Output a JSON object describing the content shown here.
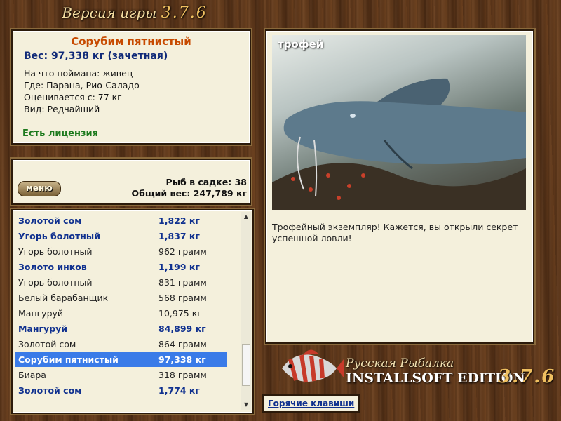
{
  "header": {
    "title_prefix": "Версия игры",
    "version": "3.7.6"
  },
  "fish_info": {
    "name": "Сорубим пятнистый",
    "weight": "Вес: 97,338 кг (зачетная)",
    "bait": "На что поймана: живец",
    "location": "Где: Парана, Рио-Саладо",
    "value": "Оценивается с: 77 кг",
    "rarity": "Вид: Редчайший",
    "license": "Есть лицензия"
  },
  "stats": {
    "menu_label": "меню",
    "fish_count": "Рыб в садке: 38",
    "total_weight": "Общий вес: 247,789 кг"
  },
  "catch_list": [
    {
      "name": "Золотой сом",
      "weight": "1,822 кг",
      "bold": true,
      "selected": false
    },
    {
      "name": "Угорь болотный",
      "weight": "1,837 кг",
      "bold": true,
      "selected": false
    },
    {
      "name": "Угорь болотный",
      "weight": "962 грамм",
      "bold": false,
      "selected": false
    },
    {
      "name": "Золото инков",
      "weight": "1,199 кг",
      "bold": true,
      "selected": false
    },
    {
      "name": "Угорь болотный",
      "weight": "831 грамм",
      "bold": false,
      "selected": false
    },
    {
      "name": "Белый барабанщик",
      "weight": "568 грамм",
      "bold": false,
      "selected": false
    },
    {
      "name": "Мангуруй",
      "weight": "10,975 кг",
      "bold": false,
      "selected": false
    },
    {
      "name": "Мангуруй",
      "weight": "84,899 кг",
      "bold": true,
      "selected": false
    },
    {
      "name": "Золотой сом",
      "weight": "864 грамм",
      "bold": false,
      "selected": false
    },
    {
      "name": "Сорубим пятнистый",
      "weight": "97,338 кг",
      "bold": true,
      "selected": true
    },
    {
      "name": "Биара",
      "weight": "318 грамм",
      "bold": false,
      "selected": false
    },
    {
      "name": "Золотой сом",
      "weight": "1,774 кг",
      "bold": true,
      "selected": false
    }
  ],
  "photo": {
    "label": "трофей"
  },
  "description": "Трофейный экземпляр! Кажется, вы открыли секрет успешной ловли!",
  "hotkeys_label": "Горячие клавиши",
  "logo": {
    "line1": "Русская Рыбалка",
    "line2": "INSTALLSOFT EDITION",
    "version": "3.7.6"
  },
  "colors": {
    "accent_orange": "#c74a00",
    "accent_blue": "#10318f",
    "selection": "#3a7be8",
    "license_green": "#1d7a1d"
  }
}
